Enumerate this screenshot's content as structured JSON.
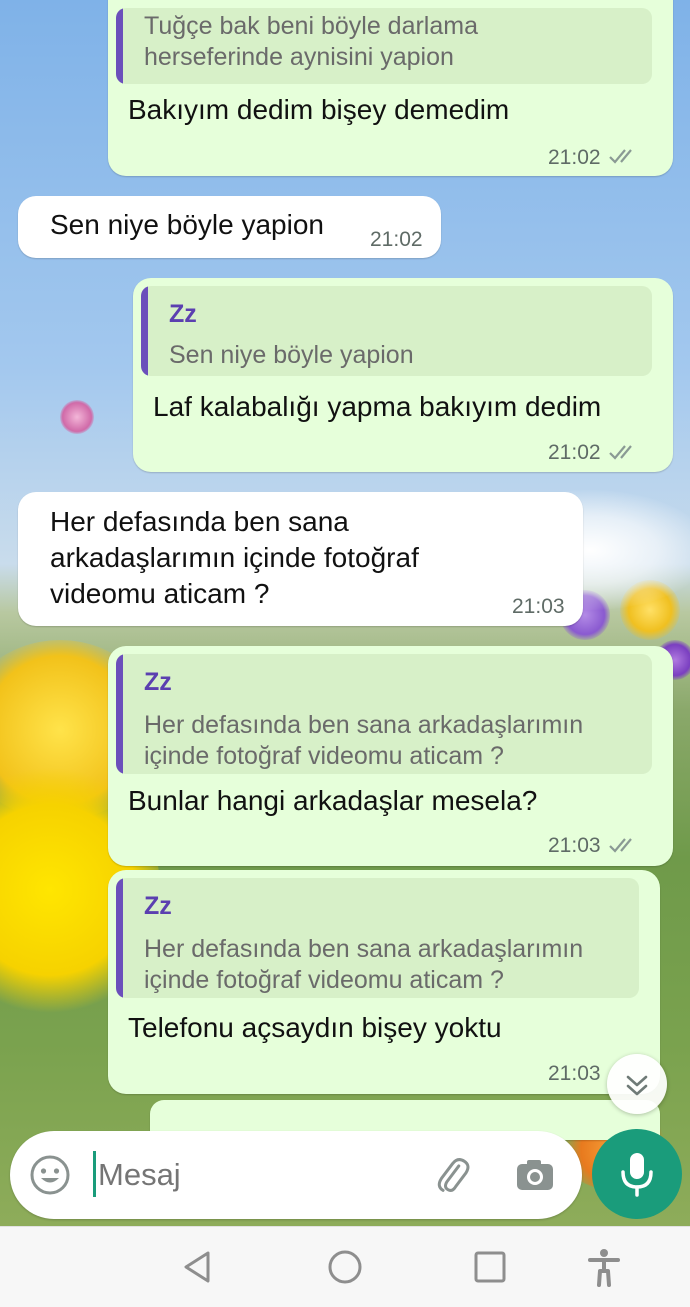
{
  "messages": [
    {
      "dir": "out",
      "quote_text_lines": [
        "Tuğçe bak beni böyle darlama",
        "herseferinde aynisini yapion"
      ],
      "text": "Bakıyım dedim bişey demedim",
      "time": "21:02"
    },
    {
      "dir": "in",
      "text": "Sen niye böyle yapion",
      "time": "21:02"
    },
    {
      "dir": "out",
      "quote_name": "Zz",
      "quote_text_lines": [
        "Sen niye böyle yapion"
      ],
      "text": "Laf kalabalığı yapma bakıyım dedim",
      "time": "21:02"
    },
    {
      "dir": "in",
      "text_lines": [
        "Her defasında ben sana",
        "arkadaşlarımın içinde fotoğraf",
        "videomu aticam ?"
      ],
      "time": "21:03"
    },
    {
      "dir": "out",
      "quote_name": "Zz",
      "quote_text_lines": [
        "Her defasında ben sana arkadaşlarımın",
        "içinde fotoğraf videomu aticam ?"
      ],
      "text": "Bunlar hangi arkadaşlar mesela?",
      "time": "21:03"
    },
    {
      "dir": "out",
      "quote_name": "Zz",
      "quote_text_lines": [
        "Her defasında ben sana arkadaşlarımın",
        "içinde fotoğraf videomu aticam ?"
      ],
      "text": "Telefonu açsaydın bişey yoktu",
      "time": "21:03"
    }
  ],
  "composer": {
    "placeholder": "Mesaj",
    "emoji_icon": "emoji-icon",
    "attach_icon": "paperclip-icon",
    "camera_icon": "camera-icon",
    "mic_icon": "microphone-icon"
  },
  "scroll_button_icon": "double-chevron-down-icon",
  "navbar": {
    "icons": [
      "back-icon",
      "home-icon",
      "recents-icon",
      "accessibility-icon"
    ]
  },
  "colors": {
    "outgoing_bubble": "#e6ffda",
    "incoming_bubble": "#ffffff",
    "quote_bar": "#6b4fbb",
    "quote_name": "#5b3fb0",
    "mic_button": "#1a9c7b",
    "read_ticks": "#8a9a94"
  }
}
